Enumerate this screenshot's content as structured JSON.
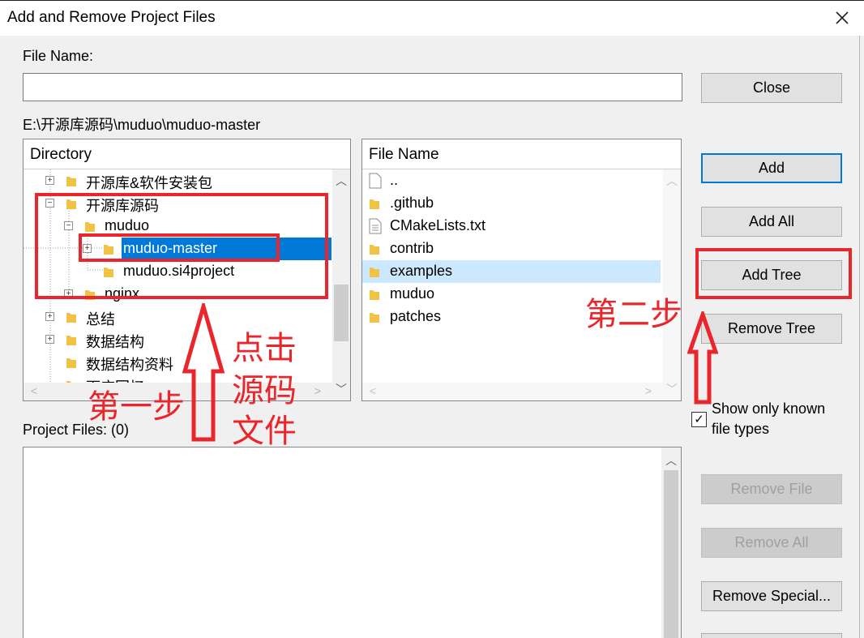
{
  "window": {
    "title": "Add and Remove Project Files"
  },
  "file_name": {
    "label": "File Name:",
    "value": ""
  },
  "current_path": "E:\\开源库源码\\muduo\\muduo-master",
  "directory": {
    "header": "Directory",
    "items": [
      {
        "label": "开源库&软件安装包",
        "expander": "+"
      },
      {
        "label": "开源库源码",
        "expander": "−"
      },
      {
        "label": "muduo",
        "expander": "−"
      },
      {
        "label": "muduo-master",
        "expander": "+",
        "selected": true
      },
      {
        "label": "muduo.si4project",
        "expander": ""
      },
      {
        "label": "nginx",
        "expander": "+"
      },
      {
        "label": "总结",
        "expander": "+"
      },
      {
        "label": "数据结构",
        "expander": "+"
      },
      {
        "label": "数据结构资料",
        "expander": ""
      },
      {
        "label": "面应回忆",
        "expander": ""
      }
    ]
  },
  "files": {
    "header": "File Name",
    "items": [
      {
        "label": "..",
        "kind": "file"
      },
      {
        "label": ".github",
        "kind": "folder"
      },
      {
        "label": "CMakeLists.txt",
        "kind": "doc"
      },
      {
        "label": "contrib",
        "kind": "folder"
      },
      {
        "label": "examples",
        "kind": "folder",
        "selected": true
      },
      {
        "label": "muduo",
        "kind": "folder"
      },
      {
        "label": "patches",
        "kind": "folder"
      }
    ]
  },
  "project_files": {
    "label": "Project Files: (0)"
  },
  "buttons": {
    "close": "Close",
    "add": "Add",
    "add_all": "Add All",
    "add_tree": "Add Tree",
    "remove_tree": "Remove Tree",
    "remove_file": "Remove File",
    "remove_all": "Remove All",
    "remove_special": "Remove Special..."
  },
  "show_known": {
    "label_line1": "Show only known",
    "label_line2": "file types",
    "checked": true,
    "mark": "✓"
  },
  "annotations": {
    "step1": "第一步",
    "click_line1": "点击",
    "click_line2": "源码",
    "click_line3": "文件",
    "step2": "第二步"
  },
  "colors": {
    "selection": "#0078d7",
    "selection_light": "#cce8ff",
    "annotation_red": "#e8262b",
    "folder": "#f0c346"
  }
}
